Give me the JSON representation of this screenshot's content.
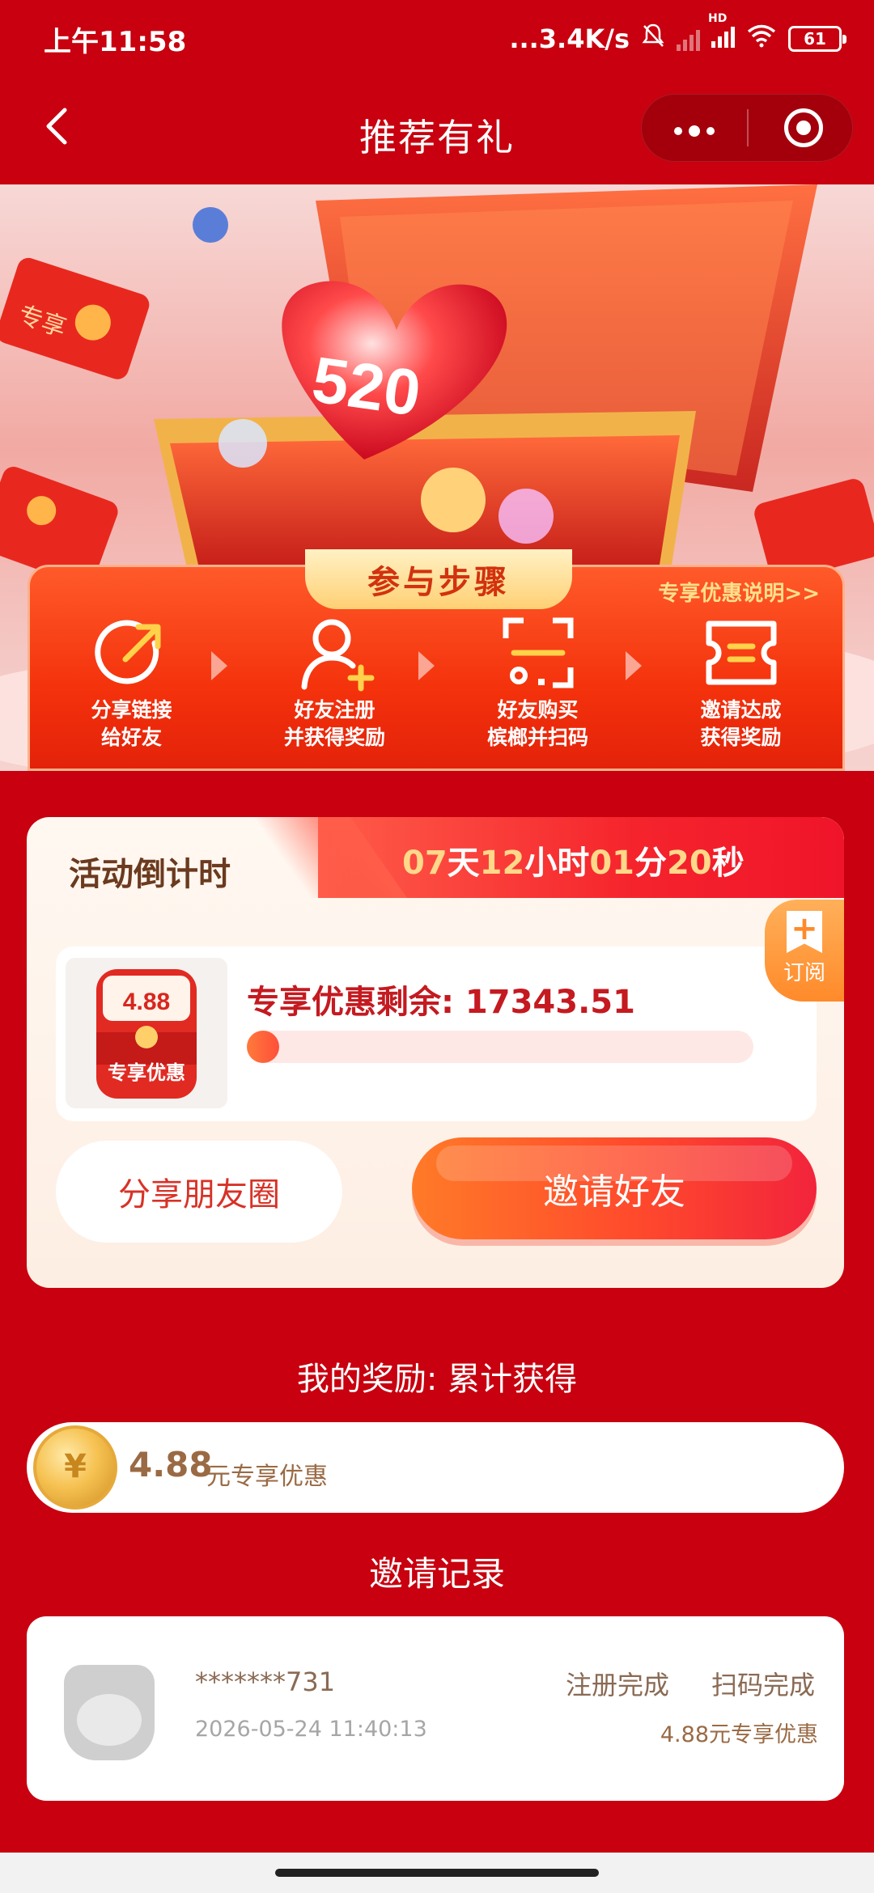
{
  "status_bar": {
    "time": "上午11:58",
    "network_speed": "...3.4K/s",
    "hd_label": "HD",
    "battery": "61"
  },
  "nav": {
    "title": "推荐有礼",
    "back_icon": "chevron-left-icon",
    "more_icon": "more-dots-icon",
    "close_icon": "target-circle-icon"
  },
  "banner": {
    "badge_text": "520",
    "red_packet_text": "专享",
    "steps_title": "参与步骤",
    "steps_link": "专享优惠说明>>",
    "steps": [
      {
        "line1": "分享链接",
        "line2": "给好友",
        "icon": "share-arrow-icon"
      },
      {
        "line1": "好友注册",
        "line2": "并获得奖励",
        "icon": "add-user-icon"
      },
      {
        "line1": "好友购买",
        "line2": "槟榔并扫码",
        "icon": "scan-icon"
      },
      {
        "line1": "邀请达成",
        "line2": "获得奖励",
        "icon": "ticket-icon"
      }
    ]
  },
  "countdown": {
    "label": "活动倒计时",
    "days": "07",
    "days_unit": "天",
    "hours": "12",
    "hours_unit": "小时",
    "minutes": "01",
    "minutes_unit": "分",
    "seconds": "20",
    "seconds_unit": "秒",
    "subscribe_label": "订阅",
    "coupon_value": "4.88",
    "coupon_caption": "专享优惠",
    "remaining_label": "专享优惠剩余: 17343.51",
    "remaining_progress": 0.04,
    "share_button": "分享朋友圈",
    "invite_button": "邀请好友"
  },
  "rewards": {
    "title": "我的奖励: 累计获得",
    "amount": "4.88",
    "unit": "元专享优惠"
  },
  "records": {
    "title": "邀请记录",
    "items": [
      {
        "name": "*******731",
        "time": "2026-05-24 11:40:13",
        "status_register": "注册完成",
        "status_scan": "扫码完成",
        "reward": "4.88元专享优惠"
      }
    ]
  },
  "colors": {
    "primary_red": "#c8000f",
    "accent_orange": "#ff5a2a",
    "gold": "#ffd88a"
  }
}
